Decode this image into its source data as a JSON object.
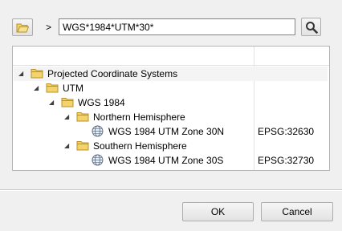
{
  "toolbar": {
    "open_icon": "folder-open-icon",
    "breadcrumb_arrow": ">",
    "search_value": "WGS*1984*UTM*30*",
    "search_icon": "magnifier-icon"
  },
  "tree": {
    "columns": [
      "",
      ""
    ],
    "rows": [
      {
        "label": "Projected Coordinate Systems",
        "code": "",
        "icon": "folder-icon",
        "expander": "expanded"
      },
      {
        "label": "UTM",
        "code": "",
        "icon": "folder-icon",
        "expander": "expanded"
      },
      {
        "label": "WGS 1984",
        "code": "",
        "icon": "folder-icon",
        "expander": "expanded"
      },
      {
        "label": "Northern Hemisphere",
        "code": "",
        "icon": "folder-icon",
        "expander": "expanded"
      },
      {
        "label": "WGS 1984 UTM Zone 30N",
        "code": "EPSG:32630",
        "icon": "globe-icon",
        "expander": "none"
      },
      {
        "label": "Southern Hemisphere",
        "code": "",
        "icon": "folder-icon",
        "expander": "expanded"
      },
      {
        "label": "WGS 1984 UTM Zone 30S",
        "code": "EPSG:32730",
        "icon": "globe-icon",
        "expander": "none"
      }
    ]
  },
  "buttons": {
    "ok": "OK",
    "cancel": "Cancel"
  },
  "colors": {
    "input_border": "#4a90d9",
    "folder_fill": "#f3d36b",
    "folder_stroke": "#b8912a"
  }
}
